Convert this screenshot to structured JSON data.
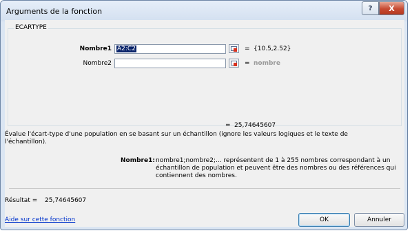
{
  "window": {
    "title": "Arguments de la fonction",
    "help_glyph": "?",
    "close_glyph": "X"
  },
  "function_name": "ECARTYPE",
  "args": [
    {
      "label": "Nombre1",
      "value": "A2:C2",
      "result": "{10.5,2.52}"
    },
    {
      "label": "Nombre2",
      "value": "",
      "result": "nombre"
    }
  ],
  "equals_sign": "=",
  "formula_result": "25,74645607",
  "description": "Évalue l'écart-type d'une population en se basant sur un échantillon (ignore les valeurs logiques et le texte de l'échantillon).",
  "arg_help": {
    "label": "Nombre1:",
    "text": "nombre1;nombre2;... représentent de 1 à 255 nombres correspondant à un échantillon de population et peuvent être des nombres ou des références qui contiennent des nombres."
  },
  "result_line": {
    "label": "Résultat =",
    "value": "25,74645607"
  },
  "help_link": "Aide sur cette fonction",
  "buttons": {
    "ok": "OK",
    "cancel": "Annuler"
  }
}
